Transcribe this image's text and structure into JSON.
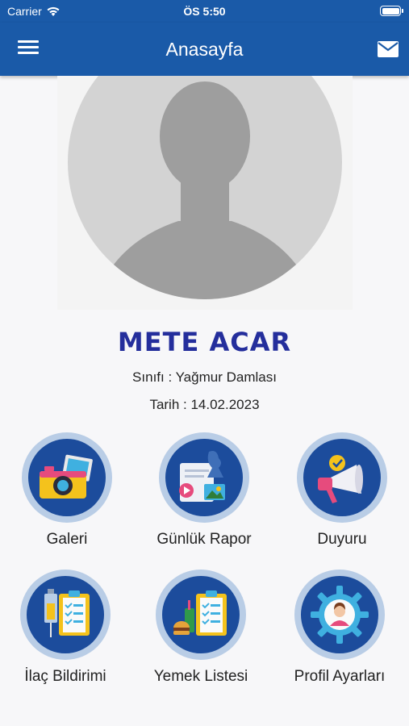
{
  "status_bar": {
    "carrier": "Carrier",
    "time": "ÖS 5:50"
  },
  "app_bar": {
    "title": "Anasayfa"
  },
  "profile": {
    "name": "METE ACAR",
    "class_line": "Sınıfı : Yağmur Damlası",
    "date_line": "Tarih : 14.02.2023"
  },
  "menu": [
    {
      "label": "Galeri",
      "icon": "gallery-icon"
    },
    {
      "label": "Günlük Rapor",
      "icon": "daily-report-icon"
    },
    {
      "label": "Duyuru",
      "icon": "announcement-icon"
    },
    {
      "label": "İlaç Bildirimi",
      "icon": "medicine-notice-icon"
    },
    {
      "label": "Yemek Listesi",
      "icon": "meal-list-icon"
    },
    {
      "label": "Profil Ayarları",
      "icon": "profile-settings-icon"
    }
  ],
  "colors": {
    "primary": "#1a5aa8",
    "name": "#242e9c",
    "tile_ring": "#b9cde6",
    "tile_fill": "#1c4c9c"
  }
}
